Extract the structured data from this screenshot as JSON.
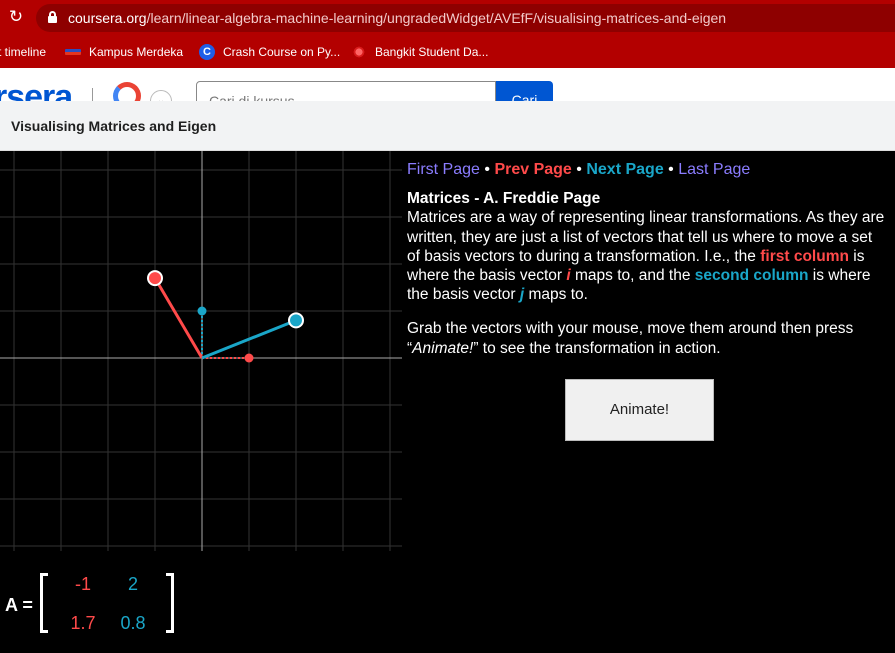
{
  "browser": {
    "url_host": "coursera.org",
    "url_path": "/learn/linear-algebra-machine-learning/ungradedWidget/AVEfF/visualising-matrices-and-eigen",
    "bookmarks": [
      {
        "label": "t timeline"
      },
      {
        "label": "Kampus Merdeka"
      },
      {
        "label": "Crash Course on Py..."
      },
      {
        "label": "Bangkit Student Da..."
      }
    ]
  },
  "coursera_header": {
    "logo_text": "rsera",
    "search_placeholder": "Cari di kursus",
    "search_button": "Cari"
  },
  "widget": {
    "title": "Visualising Matrices and Eigen",
    "nav": {
      "first": "First Page",
      "prev": "Prev Page",
      "next": "Next Page",
      "last": "Last Page",
      "separator": "•"
    },
    "heading": "Matrices - A. Freddie Page",
    "para1_part1": "Matrices are a way of representing linear transformations. As they are written, they are just a list of vectors that tell us where to move a set of basis vectors to during a transformation. I.e., the",
    "first_column": "first column",
    "para1_part2": "is where the basis vector",
    "i_vec": "i",
    "para1_part3": "maps to, and the",
    "second_column": "second column",
    "para1_part4": "is where the basis vector",
    "j_vec": "j",
    "para1_part5": "maps to.",
    "para2_part1": "Grab the vectors with your mouse, move them around then press “",
    "para2_em": "Animate!",
    "para2_part2": "” to see the transformation in action.",
    "animate_button": "Animate!",
    "matrix": {
      "label": "A =",
      "a11": "-1",
      "a12": "2",
      "a21": "1.7",
      "a22": "0.8"
    },
    "vectors": {
      "i_transformed": [
        -1,
        1.7
      ],
      "j_transformed": [
        2,
        0.8
      ]
    },
    "colors": {
      "i_color": "#ff4a4a",
      "j_color": "#1aa6c8",
      "link_color": "#8b7dff"
    }
  }
}
